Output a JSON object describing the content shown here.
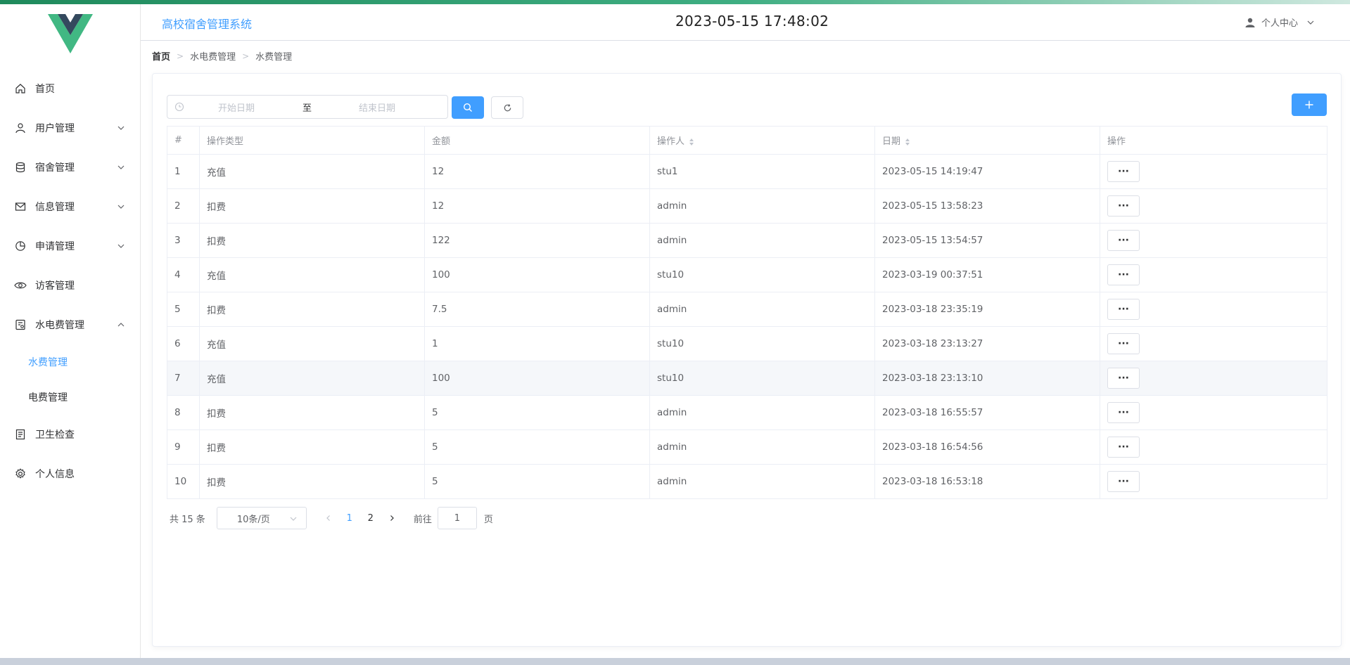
{
  "app": {
    "title": "高校宿舍管理系统",
    "datetime": "2023-05-15 17:48:02",
    "user_menu": "个人中心"
  },
  "sidebar": {
    "items": [
      {
        "label": "首页",
        "icon": "home-icon"
      },
      {
        "label": "用户管理",
        "icon": "user-icon"
      },
      {
        "label": "宿舍管理",
        "icon": "database-icon"
      },
      {
        "label": "信息管理",
        "icon": "mail-icon"
      },
      {
        "label": "申请管理",
        "icon": "pie-icon"
      },
      {
        "label": "访客管理",
        "icon": "eye-icon"
      },
      {
        "label": "水电费管理",
        "icon": "bill-icon"
      },
      {
        "label": "卫生检查",
        "icon": "document-icon"
      },
      {
        "label": "个人信息",
        "icon": "gear-icon"
      }
    ],
    "sub_items": [
      {
        "label": "水费管理",
        "active": true
      },
      {
        "label": "电费管理",
        "active": false
      }
    ],
    "accent": "#409eff"
  },
  "breadcrumb": [
    "首页",
    "水电费管理",
    "水费管理"
  ],
  "filter": {
    "start_placeholder": "开始日期",
    "separator": "至",
    "end_placeholder": "结束日期"
  },
  "table": {
    "headers": [
      "#",
      "操作类型",
      "金额",
      "操作人",
      "日期",
      "操作"
    ],
    "rows": [
      {
        "no": "1",
        "type": "充值",
        "amount": "12",
        "operator": "stu1",
        "date": "2023-05-15 14:19:47"
      },
      {
        "no": "2",
        "type": "扣费",
        "amount": "12",
        "operator": "admin",
        "date": "2023-05-15 13:58:23"
      },
      {
        "no": "3",
        "type": "扣费",
        "amount": "122",
        "operator": "admin",
        "date": "2023-05-15 13:54:57"
      },
      {
        "no": "4",
        "type": "充值",
        "amount": "100",
        "operator": "stu10",
        "date": "2023-03-19 00:37:51"
      },
      {
        "no": "5",
        "type": "扣费",
        "amount": "7.5",
        "operator": "admin",
        "date": "2023-03-18 23:35:19"
      },
      {
        "no": "6",
        "type": "充值",
        "amount": "1",
        "operator": "stu10",
        "date": "2023-03-18 23:13:27"
      },
      {
        "no": "7",
        "type": "充值",
        "amount": "100",
        "operator": "stu10",
        "date": "2023-03-18 23:13:10"
      },
      {
        "no": "8",
        "type": "扣费",
        "amount": "5",
        "operator": "admin",
        "date": "2023-03-18 16:55:57"
      },
      {
        "no": "9",
        "type": "扣费",
        "amount": "5",
        "operator": "admin",
        "date": "2023-03-18 16:54:56"
      },
      {
        "no": "10",
        "type": "扣费",
        "amount": "5",
        "operator": "admin",
        "date": "2023-03-18 16:53:18"
      }
    ],
    "more_label": "···"
  },
  "pagination": {
    "total": "共 15 条",
    "page_size": "10条/页",
    "pages": [
      "1",
      "2"
    ],
    "current": "1",
    "goto_label": "前往",
    "goto_value": "1",
    "page_suffix": "页"
  }
}
